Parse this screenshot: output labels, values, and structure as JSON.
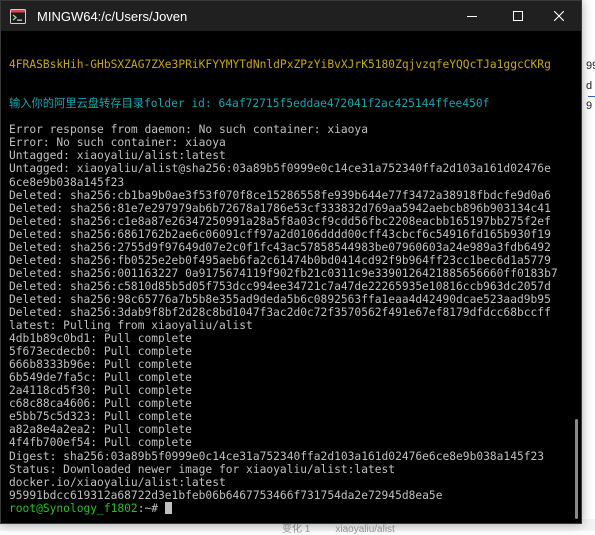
{
  "background": {
    "right_text": [
      "99",
      "d",
      "9"
    ],
    "bottom_caption": "变化 1         xiaoyaliu/alist"
  },
  "window": {
    "title": "MINGW64:/c/Users/Joven",
    "minimize_glyph": "—",
    "maximize_glyph": "☐",
    "close_glyph": "✕",
    "app_icon": "mingw-terminal-icon"
  },
  "colors": {
    "terminal_bg": "#000000",
    "yellow": "#c8a700",
    "cyan": "#13a6b3",
    "green": "#21c421",
    "text": "#c0c0c0"
  },
  "console": {
    "lines": [
      {
        "text": "4FRASBskHih-GHbSXZAG7ZXe3PRiKFYYMYTdNnldPxZPzYiBvXJrK5180ZqjvzqfeYQQcTJa1ggcCKRg",
        "color": "yellow"
      },
      {
        "text": "",
        "color": "white"
      },
      {
        "text": "",
        "color": "white"
      },
      {
        "text": "输入你的阿里云盘转存目录folder id: 64af72715f5eddae472041f2ac425144ffee450f",
        "color": "cyan"
      },
      {
        "text": "",
        "color": "white"
      },
      {
        "text": "Error response from daemon: No such container: xiaoya",
        "color": "white"
      },
      {
        "text": "Error: No such container: xiaoya",
        "color": "white"
      },
      {
        "text": "Untagged: xiaoyaliu/alist:latest",
        "color": "white"
      },
      {
        "text": "Untagged: xiaoyaliu/alist@sha256:03a89b5f0999e0c14ce31a752340ffa2d103a161d02476e",
        "color": "white"
      },
      {
        "text": "6ce8e9b038a145f23",
        "color": "white"
      },
      {
        "text": "Deleted: sha256:cb1ba9b0ae3f53f070f8ce15286558fe939b644e77f3472a38918fbdcfe9d0a6",
        "color": "white"
      },
      {
        "text": "Deleted: sha256:81e7e297979ab6b72678a1786e53cf333832d769aa5942aebcb896b903134c41",
        "color": "white"
      },
      {
        "text": "Deleted: sha256:c1e8a87e26347250991a28a5f8a03cf9cdd56fbc2208eacbb165197bb275f2ef",
        "color": "white"
      },
      {
        "text": "Deleted: sha256:6861762b2ae6c06091cff97a2d0106dddd00cff43cbcf6c54916fd165b930f19",
        "color": "white"
      },
      {
        "text": "Deleted: sha256:2755d9f97649d07e2c0f1fc43ac57858544983be07960603a24e989a3fdb6492",
        "color": "white"
      },
      {
        "text": "Deleted: sha256:fb0525e2eb0f495aeb6fa2c61474b0bd0414cd92f9b964ff23cc1bec6d1a5779",
        "color": "white"
      },
      {
        "text": "Deleted: sha256:001163227 0a9175674119f902fb21c0311c9e3390126421885656660ff0183b7",
        "color": "white"
      },
      {
        "text": "Deleted: sha256:c5810d85b5d05f753dcc994ee34721c7a47de22265935e10816ccb963dc2057d",
        "color": "white"
      },
      {
        "text": "Deleted: sha256:98c65776a7b5b8e355ad9deda5b6c0892563ffa1eaa4d42490dcae523aad9b95",
        "color": "white"
      },
      {
        "text": "Deleted: sha256:3dab9f8bf2d28c8bd1047f3ac2d0c72f3570562f491e67ef8179dfdcc68bccff",
        "color": "white"
      },
      {
        "text": "latest: Pulling from xiaoyaliu/alist",
        "color": "white"
      },
      {
        "text": "4db1b89c0bd1: Pull complete",
        "color": "white"
      },
      {
        "text": "5f673ecdecb0: Pull complete",
        "color": "white"
      },
      {
        "text": "666b8333b96e: Pull complete",
        "color": "white"
      },
      {
        "text": "6b549de7fa5c: Pull complete",
        "color": "white"
      },
      {
        "text": "2a4118cd5f30: Pull complete",
        "color": "white"
      },
      {
        "text": "c68c88ca4606: Pull complete",
        "color": "white"
      },
      {
        "text": "e5bb75c5d323: Pull complete",
        "color": "white"
      },
      {
        "text": "a82a8e4a2ea2: Pull complete",
        "color": "white"
      },
      {
        "text": "4f4fb700ef54: Pull complete",
        "color": "white"
      },
      {
        "text": "Digest: sha256:03a89b5f0999e0c14ce31a752340ffa2d103a161d02476e6ce8e9b038a145f23",
        "color": "white"
      },
      {
        "text": "Status: Downloaded newer image for xiaoyaliu/alist:latest",
        "color": "white"
      },
      {
        "text": "docker.io/xiaoyaliu/alist:latest",
        "color": "white"
      },
      {
        "text": "95991bdcc619312a68722d3e1bfeb06b6467753466f731754da2e72945d8ea5e",
        "color": "white"
      }
    ],
    "prompt_user": "root@Synology_f1802",
    "prompt_sep": ":",
    "prompt_path": "~",
    "prompt_symbol": "# "
  }
}
